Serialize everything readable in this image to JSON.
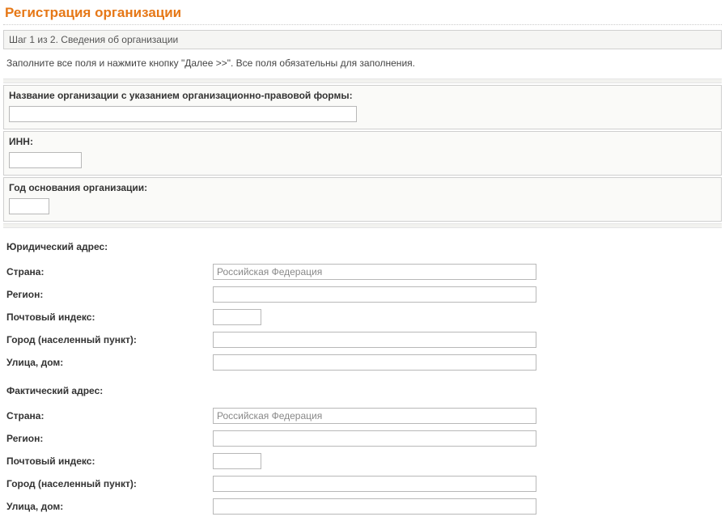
{
  "page": {
    "title": "Регистрация организации",
    "step": "Шаг 1 из 2. Сведения об организации",
    "instructions": "Заполните все поля и нажмите кнопку \"Далее >>\". Все поля обязательны для заполнения."
  },
  "org": {
    "name_label": "Название организации с указанием организационно-правовой формы:",
    "name_value": "",
    "inn_label": "ИНН:",
    "inn_value": "",
    "year_label": "Год основания организации:",
    "year_value": ""
  },
  "legal": {
    "heading": "Юридический адрес:",
    "country_label": "Страна:",
    "country_value": "Российская Федерация",
    "region_label": "Регион:",
    "region_value": "",
    "zip_label": "Почтовый индекс:",
    "zip_value": "",
    "city_label": "Город (населенный пункт):",
    "city_value": "",
    "street_label": "Улица, дом:",
    "street_value": ""
  },
  "actual": {
    "heading": "Фактический адрес:",
    "country_label": "Страна:",
    "country_value": "Российская Федерация",
    "region_label": "Регион:",
    "region_value": "",
    "zip_label": "Почтовый индекс:",
    "zip_value": "",
    "city_label": "Город (населенный пункт):",
    "city_value": "",
    "street_label": "Улица, дом:",
    "street_value": ""
  }
}
